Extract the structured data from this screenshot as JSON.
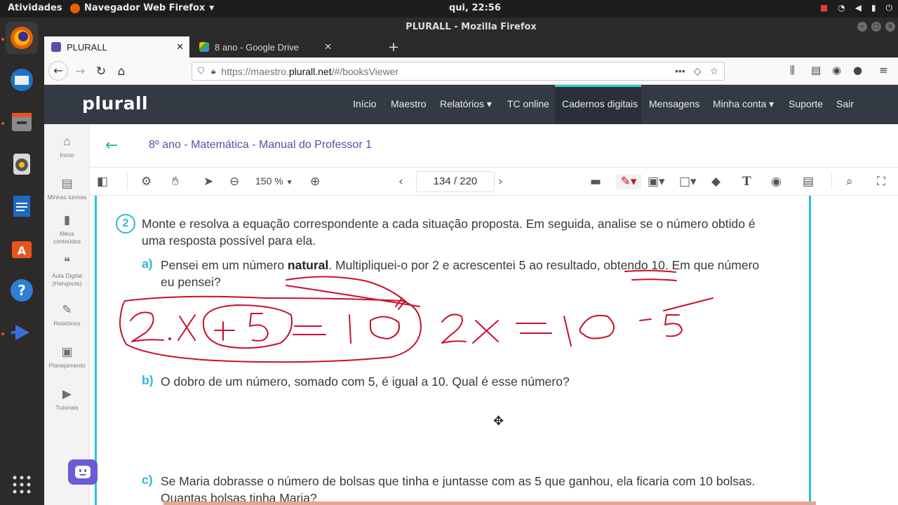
{
  "system_bar": {
    "activities": "Atividades",
    "app_menu": "Navegador Web Firefox",
    "clock": "qui, 22:56"
  },
  "window": {
    "title": "PLURALL - Mozilla Firefox"
  },
  "tabs": [
    {
      "label": "PLURALL",
      "active": true
    },
    {
      "label": "8 ano - Google Drive",
      "active": false
    }
  ],
  "urlbar": {
    "prefix": "https://maestro.",
    "domain": "plurall.net",
    "suffix": "/#/booksViewer"
  },
  "plurall": {
    "logo": "plurall",
    "nav": [
      {
        "label": "Início"
      },
      {
        "label": "Maestro"
      },
      {
        "label": "Relatórios ▾"
      },
      {
        "label": "TC online"
      },
      {
        "label": "Cadernos digitais"
      },
      {
        "label": "Mensagens"
      },
      {
        "label": "Minha conta ▾"
      },
      {
        "label": "Suporte"
      },
      {
        "label": "Sair"
      }
    ]
  },
  "sidebar": [
    {
      "label": "Início"
    },
    {
      "label": "Minhas turmas"
    },
    {
      "label": "Meus conteúdos"
    },
    {
      "label": "Aula Digital (Hangouts)"
    },
    {
      "label": "Relatórios"
    },
    {
      "label": "Planejamento"
    },
    {
      "label": "Tutoriais"
    }
  ],
  "book": {
    "title": "8º ano - Matemática - Manual do Professor 1"
  },
  "viewer": {
    "zoom": "150 %",
    "page": "134 / 220"
  },
  "document": {
    "question_number": "2",
    "question_text_1": "Monte e resolva a equação correspondente a cada situação proposta. Em seguida, analise se o número obtido é",
    "question_text_2": "uma resposta possível para ela.",
    "item_a_letter": "a)",
    "item_a_pre": "Pensei em um número ",
    "item_a_bold": "natural",
    "item_a_post": ". Multipliquei-o por 2 e acrescentei 5 ao resultado, obtendo 10. Em que número",
    "item_a_line2": "eu pensei?",
    "item_b_letter": "b)",
    "item_b_text": "O dobro de um número, somado com 5, é igual a 10. Qual é esse número?",
    "item_c_letter": "c)",
    "item_c_text": "Se Maria dobrasse o número de bolsas que tinha e juntasse com as 5 que ganhou, ela ficaria com 10 bolsas.",
    "item_c_line2": "Quantas bolsas tinha Maria?"
  },
  "colors": {
    "ink": "#c8102e",
    "accent_teal": "#2bd1c4",
    "brand_purple": "#5c4da5",
    "header_bg": "#333a44"
  }
}
